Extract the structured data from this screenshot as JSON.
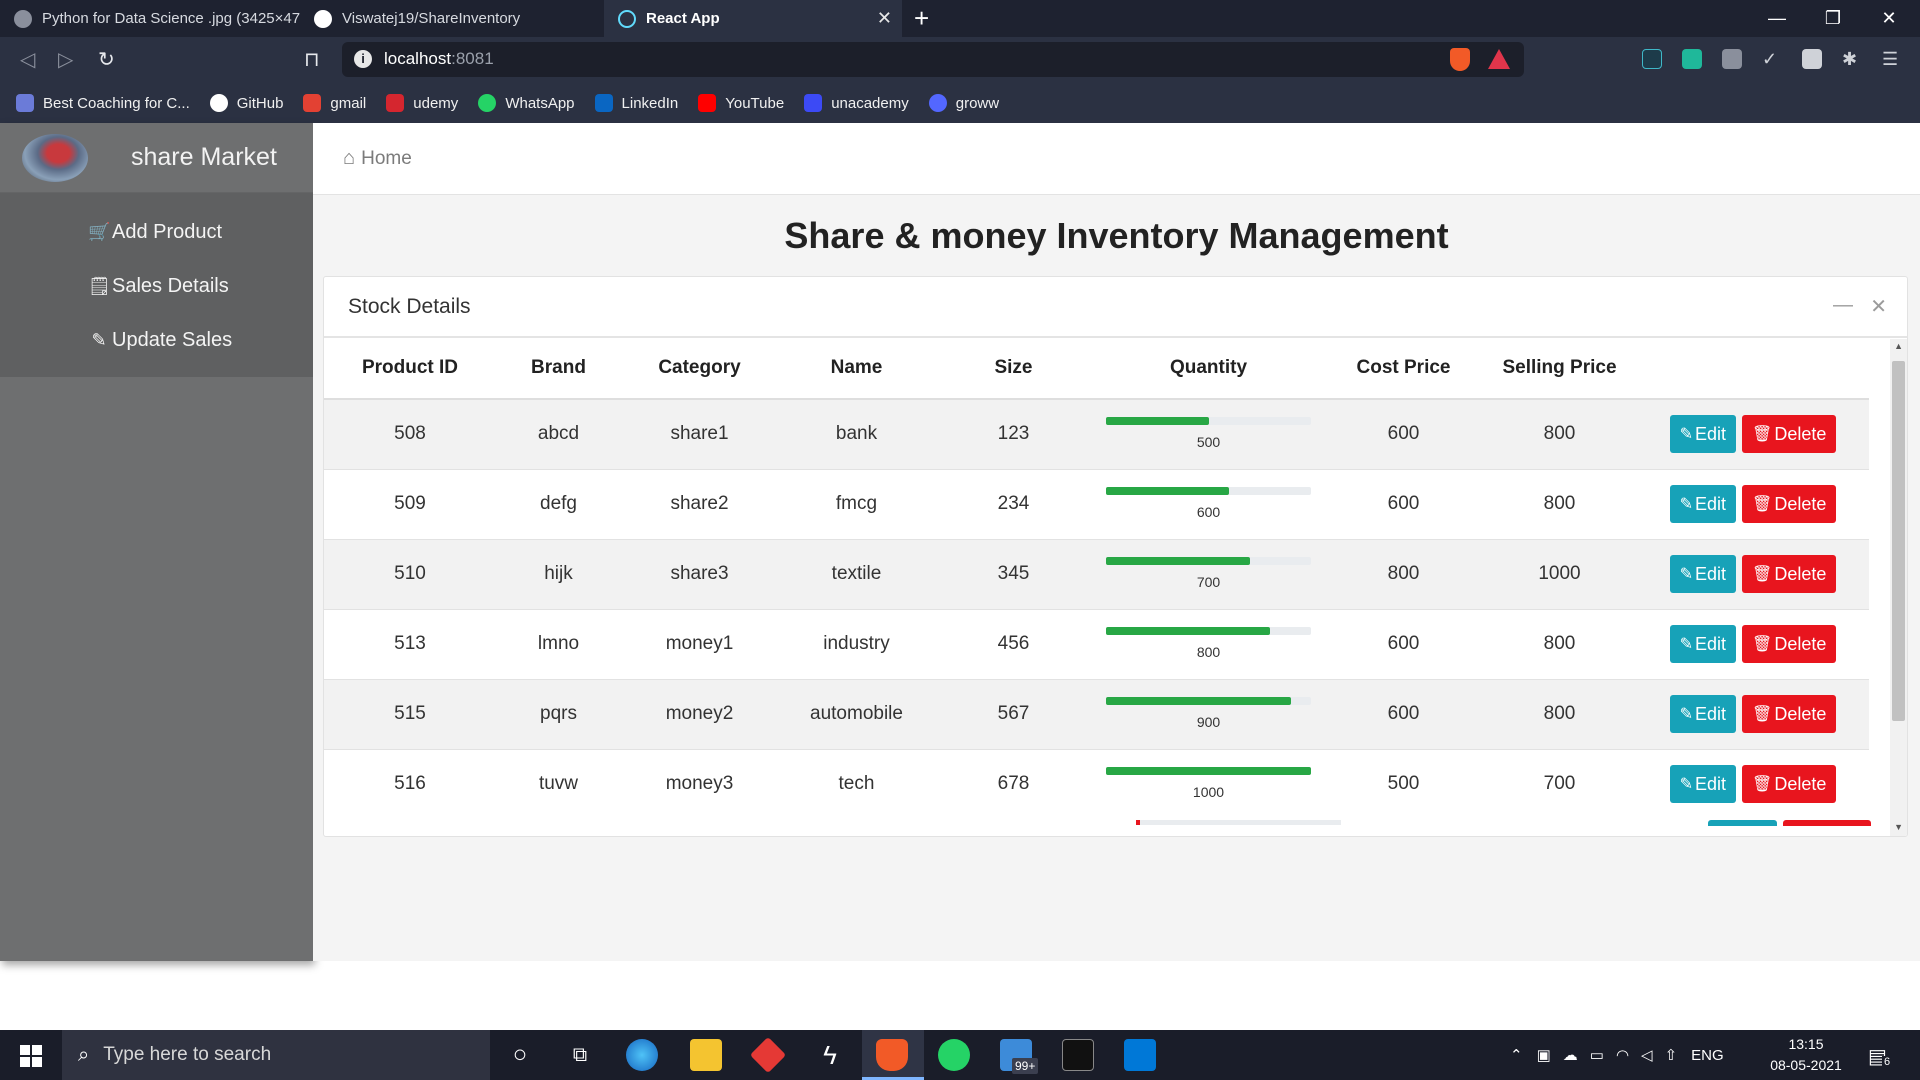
{
  "browser": {
    "tabs": [
      {
        "title": "Python for Data Science .jpg (3425×47",
        "active": false
      },
      {
        "title": "Viswatej19/ShareInventory",
        "active": false
      },
      {
        "title": "React App",
        "active": true
      }
    ],
    "url_host": "localhost",
    "url_port": ":8081",
    "bookmarks": [
      {
        "label": "Best Coaching for C...",
        "icon": "coaching-icon",
        "color": "#6b7bd8"
      },
      {
        "label": "GitHub",
        "icon": "github-icon",
        "color": "#2b3142"
      },
      {
        "label": "gmail",
        "icon": "gmail-icon",
        "color": "#e34133"
      },
      {
        "label": "udemy",
        "icon": "udemy-icon",
        "color": "#d5262f"
      },
      {
        "label": "WhatsApp",
        "icon": "whatsapp-icon",
        "color": "#25d366"
      },
      {
        "label": "LinkedIn",
        "icon": "linkedin-icon",
        "color": "#0a66c2"
      },
      {
        "label": "YouTube",
        "icon": "youtube-icon",
        "color": "#ff0000"
      },
      {
        "label": "unacademy",
        "icon": "unacademy-icon",
        "color": "#3c4af5"
      },
      {
        "label": "groww",
        "icon": "groww-icon",
        "color": "#5367ff"
      }
    ]
  },
  "sidebar": {
    "title": "share Market",
    "items": [
      {
        "label": "Add Product",
        "icon": "cart-plus-icon"
      },
      {
        "label": "Sales Details",
        "icon": "receipt-icon"
      },
      {
        "label": "Update Sales",
        "icon": "pencil-icon"
      }
    ]
  },
  "topnav": {
    "home_label": "Home"
  },
  "main": {
    "title": "Share & money Inventory Management",
    "card_title": "Stock Details",
    "columns": [
      "Product ID",
      "Brand",
      "Category",
      "Name",
      "Size",
      "Quantity",
      "Cost Price",
      "Selling Price"
    ],
    "edit_label": "Edit",
    "delete_label": "Delete",
    "quantity_max": 1000,
    "rows": [
      {
        "id": "508",
        "brand": "abcd",
        "category": "share1",
        "name": "bank",
        "size": "123",
        "quantity": "500",
        "cost": "600",
        "selling": "800"
      },
      {
        "id": "509",
        "brand": "defg",
        "category": "share2",
        "name": "fmcg",
        "size": "234",
        "quantity": "600",
        "cost": "600",
        "selling": "800"
      },
      {
        "id": "510",
        "brand": "hijk",
        "category": "share3",
        "name": "textile",
        "size": "345",
        "quantity": "700",
        "cost": "800",
        "selling": "1000"
      },
      {
        "id": "513",
        "brand": "lmno",
        "category": "money1",
        "name": "industry",
        "size": "456",
        "quantity": "800",
        "cost": "600",
        "selling": "800"
      },
      {
        "id": "515",
        "brand": "pqrs",
        "category": "money2",
        "name": "automobile",
        "size": "567",
        "quantity": "900",
        "cost": "600",
        "selling": "800"
      },
      {
        "id": "516",
        "brand": "tuvw",
        "category": "money3",
        "name": "tech",
        "size": "678",
        "quantity": "1000",
        "cost": "500",
        "selling": "700"
      }
    ]
  },
  "taskbar": {
    "search_placeholder": "Type here to search",
    "language": "ENG",
    "time": "13:15",
    "date": "08-05-2021",
    "notification_count": "6",
    "folder_badge": "99+"
  }
}
